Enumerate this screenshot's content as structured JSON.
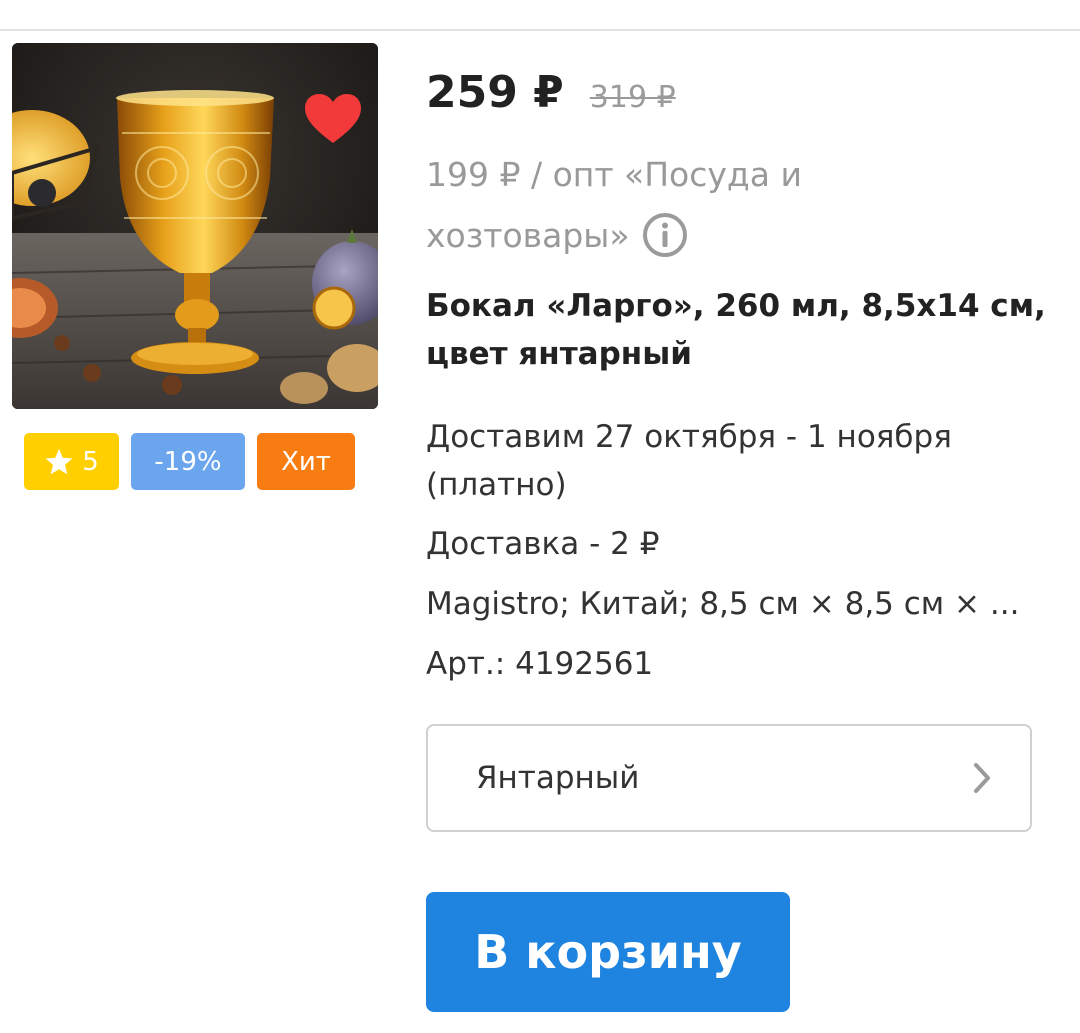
{
  "product": {
    "image_alt": "Amber embossed glass goblet",
    "favorite": true,
    "price": "259 ₽",
    "old_price": "319 ₽",
    "wholesale_text": "199 ₽ / опт «Посуда и хозтовары»",
    "title": "Бокал «Ларго», 260 мл, 8,5х14 см, цвет янтарный",
    "delivery": "Доставим 27 октября - 1 ноября (платно)",
    "delivery_cost": "Доставка - 2 ₽",
    "specs": "Magistro; Китай; 8,5 см × 8,5 см × ...",
    "sku": "Арт.: 4192561"
  },
  "badges": {
    "rating": "5",
    "discount": "-19%",
    "hit": "Хит"
  },
  "variant": {
    "selected": "Янтарный"
  },
  "actions": {
    "add_to_cart": "В корзину"
  },
  "colors": {
    "rating_badge": "#ffcf00",
    "discount_badge": "#6aa5ee",
    "hit_badge": "#f77c12",
    "cart_button": "#1e84df",
    "favorite_heart": "#f23a3a",
    "muted_text": "#999999"
  },
  "icons": {
    "favorite": "heart-icon",
    "rating": "star-icon",
    "info": "info-icon",
    "variant": "chevron-right-icon"
  }
}
